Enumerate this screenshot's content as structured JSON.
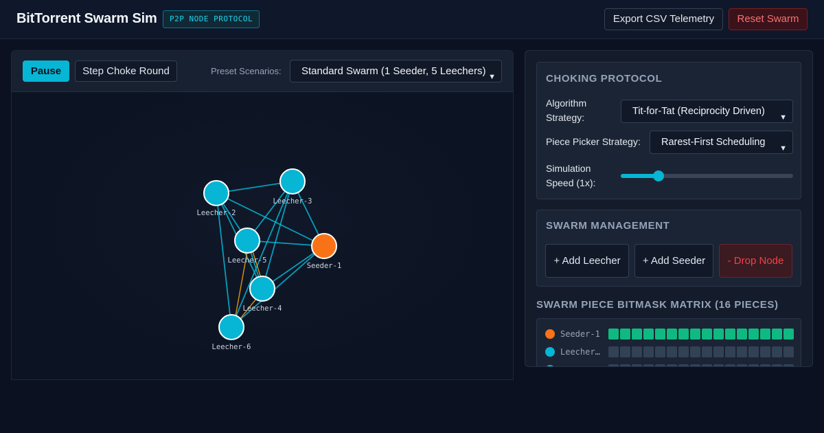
{
  "header": {
    "title": "BitTorrent Swarm Sim",
    "badge": "P2P NODE PROTOCOL",
    "export_label": "Export CSV Telemetry",
    "reset_label": "Reset Swarm"
  },
  "toolbar": {
    "pause_label": "Pause",
    "step_label": "Step Choke Round",
    "preset_label": "Preset Scenarios:",
    "preset_value": "Standard Swarm (1 Seeder, 5 Leechers)"
  },
  "graph": {
    "nodes": [
      {
        "id": "Leecher-2",
        "type": "leecher"
      },
      {
        "id": "Leecher-3",
        "type": "leecher"
      },
      {
        "id": "Leecher-5",
        "type": "leecher"
      },
      {
        "id": "Seeder-1",
        "type": "seeder"
      },
      {
        "id": "Leecher-4",
        "type": "leecher"
      },
      {
        "id": "Leecher-6",
        "type": "leecher"
      }
    ],
    "colors": {
      "leecher": "#06b6d4",
      "seeder": "#f97316",
      "link": "#06b6d4",
      "transfer_link": "#f59e0b"
    }
  },
  "choking": {
    "title": "CHOKING PROTOCOL",
    "algo_label": "Algorithm Strategy:",
    "algo_value": "Tit-for-Tat (Reciprocity Driven)",
    "picker_label": "Piece Picker Strategy:",
    "picker_value": "Rarest-First Scheduling",
    "speed_label": "Simulation Speed (1x):",
    "speed_level": 0.22
  },
  "management": {
    "title": "SWARM MANAGEMENT",
    "add_leecher": "+ Add Leecher",
    "add_seeder": "+ Add Seeder",
    "drop_node": "- Drop Node"
  },
  "matrix": {
    "title": "SWARM PIECE BITMASK MATRIX (16 PIECES)",
    "piece_count": 16,
    "colors": {
      "have": "#10b981",
      "missing": "#334155"
    },
    "rows": [
      {
        "name": "Seeder-1",
        "color": "#f97316",
        "have": [
          1,
          1,
          1,
          1,
          1,
          1,
          1,
          1,
          1,
          1,
          1,
          1,
          1,
          1,
          1,
          1
        ]
      },
      {
        "name": "Leecher…",
        "color": "#06b6d4",
        "have": [
          0,
          0,
          0,
          0,
          0,
          0,
          0,
          0,
          0,
          0,
          0,
          0,
          0,
          0,
          0,
          0
        ]
      },
      {
        "name": "",
        "color": "#06b6d4",
        "have": [
          0,
          0,
          0,
          0,
          0,
          0,
          0,
          0,
          0,
          0,
          0,
          0,
          0,
          0,
          0,
          0
        ]
      }
    ]
  }
}
